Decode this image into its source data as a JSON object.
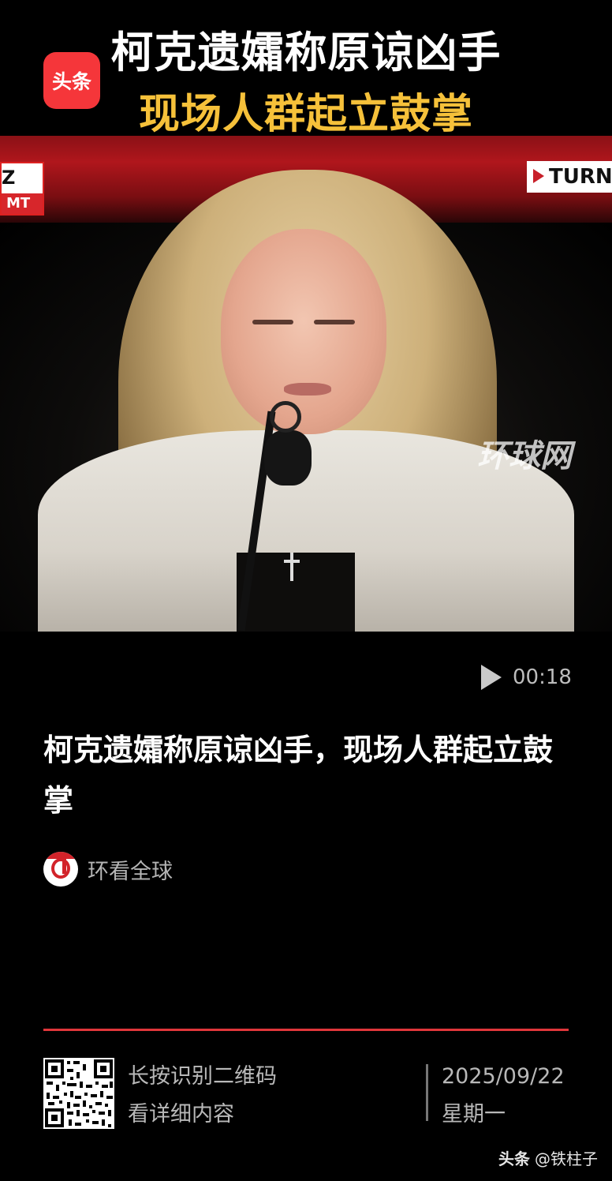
{
  "video": {
    "headline_line1": "柯克遗孀称原谅凶手",
    "headline_line2": "现场人群起立鼓掌",
    "logo_text": "头条",
    "chyron_left_top": "Z",
    "chyron_left_bottom": "MT",
    "chyron_right": "TURN",
    "watermark": "环球网",
    "duration": "00:18",
    "accent_color": "#f6c13a",
    "brand_color": "#f5363a"
  },
  "article": {
    "title": "柯克遗孀称原谅凶手，现场人群起立鼓掌",
    "author": "环看全球"
  },
  "share_card": {
    "qr_line1": "长按识别二维码",
    "qr_line2": "看详细内容",
    "date": "2025/09/22",
    "weekday": "星期一"
  },
  "footer": {
    "brand": "头条",
    "handle": "@铁柱子"
  }
}
